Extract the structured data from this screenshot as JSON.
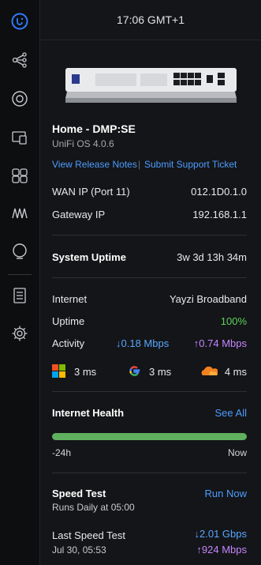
{
  "header": {
    "time": "17:06 GMT+1"
  },
  "device": {
    "name": "Home - DMP:SE",
    "os": "UniFi OS 4.0.6",
    "release_notes": "View Release Notes",
    "link_sep": "|",
    "support": "Submit Support Ticket"
  },
  "network": {
    "wan_label": "WAN IP (Port 11)",
    "wan_value": "012.1D0.1.0",
    "gw_label": "Gateway IP",
    "gw_value": "192.168.1.1"
  },
  "uptime": {
    "label": "System Uptime",
    "value": "3w 3d 13h 34m"
  },
  "internet": {
    "label": "Internet",
    "isp": "Yayzi Broadband",
    "uptime_label": "Uptime",
    "uptime_value": "100%",
    "activity_label": "Activity",
    "down": "0.18 Mbps",
    "up": "0.74 Mbps",
    "down_color": "#58a6ff",
    "up_color": "#c586ff",
    "green": "#5dd35d",
    "latency": [
      {
        "icon": "microsoft-icon",
        "value": "3 ms"
      },
      {
        "icon": "google-icon",
        "value": "3 ms"
      },
      {
        "icon": "cloudflare-icon",
        "value": "4 ms"
      }
    ]
  },
  "health": {
    "label": "Internet Health",
    "see_all": "See All",
    "left": "-24h",
    "right": "Now",
    "level": 1.0
  },
  "speedtest": {
    "label": "Speed Test",
    "schedule": "Runs Daily at 05:00",
    "run": "Run Now",
    "last_label": "Last Speed Test",
    "last_time": "Jul 30, 05:53",
    "down": "2.01 Gbps",
    "up": "924 Mbps"
  },
  "sidebar": [
    "unifi-logo-icon",
    "topology-icon",
    "target-icon",
    "devices-icon",
    "clients-icon",
    "insights-icon",
    "radar-icon",
    "logs-icon",
    "settings-icon"
  ]
}
